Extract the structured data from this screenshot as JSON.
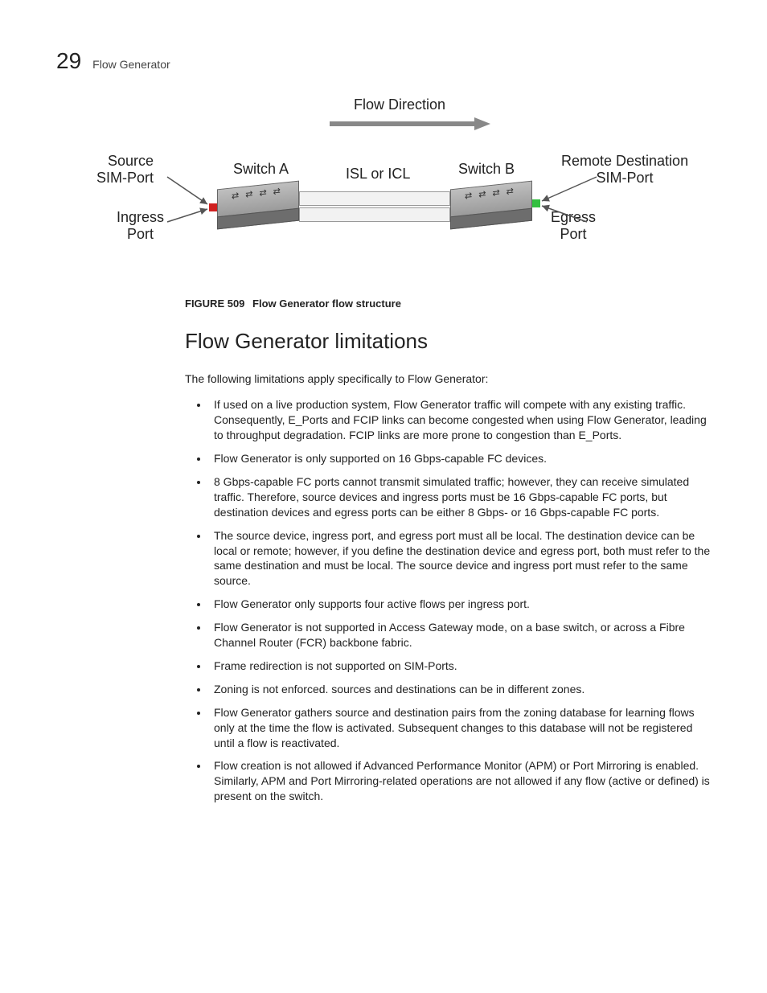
{
  "header": {
    "number": "29",
    "title": "Flow Generator"
  },
  "figure": {
    "number": "FIGURE 509",
    "caption": "Flow Generator flow structure",
    "labels": {
      "flow_direction": "Flow Direction",
      "source_sim_port": "Source\nSIM-Port",
      "switch_a": "Switch A",
      "isl_or_icl": "ISL or ICL",
      "switch_b": "Switch B",
      "remote_dest_sim_port": "Remote Destination\nSIM-Port",
      "ingress_port": "Ingress\nPort",
      "egress_port": "Egress\nPort"
    }
  },
  "section": {
    "title": "Flow Generator limitations",
    "intro": "The following limitations apply specifically to Flow Generator:",
    "bullets": [
      "If used on a live production system, Flow Generator traffic will compete with any existing traffic. Consequently, E_Ports and FCIP links can become congested when using Flow Generator, leading to throughput degradation. FCIP links are more prone to congestion than E_Ports.",
      "Flow Generator is only supported on 16 Gbps-capable FC devices.",
      "8 Gbps-capable FC ports cannot transmit simulated traffic; however, they can receive simulated traffic. Therefore, source devices and ingress ports must be 16 Gbps-capable FC ports, but destination devices and egress ports can be either 8 Gbps- or 16 Gbps-capable FC ports.",
      "The source device, ingress port, and egress port must all be local. The destination device can be local or remote; however, if you define the destination device and egress port, both must refer to the same destination and must be local. The source device and ingress port must refer to the same source.",
      "Flow Generator only supports four active flows per ingress port.",
      "Flow Generator is not supported in Access Gateway mode, on a base switch, or across a Fibre Channel Router (FCR) backbone fabric.",
      "Frame redirection is not supported on SIM-Ports.",
      "Zoning is not enforced. sources and destinations can be in different zones.",
      "Flow Generator gathers source and destination pairs from the zoning database for learning flows only at the time the flow is activated. Subsequent changes to this database will not be registered until a flow is reactivated.",
      "Flow creation is not allowed if Advanced Performance Monitor (APM) or Port Mirroring is enabled. Similarly, APM and Port Mirroring-related operations are not allowed if any flow (active or defined) is present on the switch."
    ]
  }
}
